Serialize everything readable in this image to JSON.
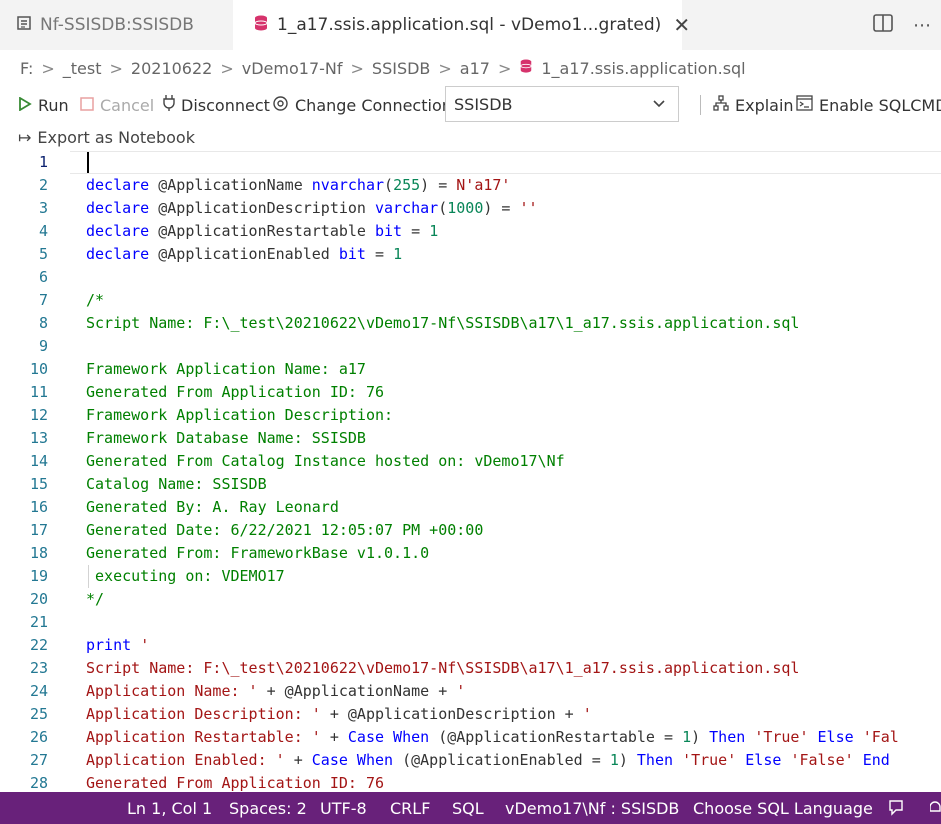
{
  "tabs": [
    {
      "label": "Nf-SSISDB:SSISDB",
      "icon": "query-doc-icon",
      "active": false
    },
    {
      "label": "1_a17.ssis.application.sql - vDemo1...grated)",
      "icon": "database-icon",
      "active": true,
      "close": "✕"
    }
  ],
  "breadcrumb": [
    "F:",
    "_test",
    "20210622",
    "vDemo17-Nf",
    "SSISDB",
    "a17",
    "1_a17.ssis.application.sql"
  ],
  "toolbar": {
    "run": "Run",
    "cancel": "Cancel",
    "disconnect": "Disconnect",
    "change_connection": "Change Connection",
    "database": "SSISDB",
    "explain": "Explain",
    "enable_sqlcmd": "Enable SQLCMD",
    "export_notebook": "Export as Notebook"
  },
  "editor": {
    "lines": [
      {
        "n": "1",
        "t": [
          {
            "c": "id",
            "v": ""
          }
        ]
      },
      {
        "n": "2",
        "t": [
          {
            "c": "kw",
            "v": "declare"
          },
          {
            "c": "id",
            "v": " @ApplicationName "
          },
          {
            "c": "kw",
            "v": "nvarchar"
          },
          {
            "c": "id",
            "v": "("
          },
          {
            "c": "nm",
            "v": "255"
          },
          {
            "c": "id",
            "v": ") = "
          },
          {
            "c": "st",
            "v": "N'a17'"
          }
        ]
      },
      {
        "n": "3",
        "t": [
          {
            "c": "kw",
            "v": "declare"
          },
          {
            "c": "id",
            "v": " @ApplicationDescription "
          },
          {
            "c": "kw",
            "v": "varchar"
          },
          {
            "c": "id",
            "v": "("
          },
          {
            "c": "nm",
            "v": "1000"
          },
          {
            "c": "id",
            "v": ") = "
          },
          {
            "c": "st",
            "v": "''"
          }
        ]
      },
      {
        "n": "4",
        "t": [
          {
            "c": "kw",
            "v": "declare"
          },
          {
            "c": "id",
            "v": " @ApplicationRestartable "
          },
          {
            "c": "kw",
            "v": "bit"
          },
          {
            "c": "id",
            "v": " = "
          },
          {
            "c": "nm",
            "v": "1"
          }
        ]
      },
      {
        "n": "5",
        "t": [
          {
            "c": "kw",
            "v": "declare"
          },
          {
            "c": "id",
            "v": " @ApplicationEnabled "
          },
          {
            "c": "kw",
            "v": "bit"
          },
          {
            "c": "id",
            "v": " = "
          },
          {
            "c": "nm",
            "v": "1"
          }
        ]
      },
      {
        "n": "6",
        "t": []
      },
      {
        "n": "7",
        "t": [
          {
            "c": "cm",
            "v": "/*"
          }
        ]
      },
      {
        "n": "8",
        "t": [
          {
            "c": "cm",
            "v": "Script Name: F:\\_test\\20210622\\vDemo17-Nf\\SSISDB\\a17\\1_a17.ssis.application.sql"
          }
        ]
      },
      {
        "n": "9",
        "t": []
      },
      {
        "n": "10",
        "t": [
          {
            "c": "cm",
            "v": "Framework Application Name: a17"
          }
        ]
      },
      {
        "n": "11",
        "t": [
          {
            "c": "cm",
            "v": "Generated From Application ID: 76"
          }
        ]
      },
      {
        "n": "12",
        "t": [
          {
            "c": "cm",
            "v": "Framework Application Description:"
          }
        ]
      },
      {
        "n": "13",
        "t": [
          {
            "c": "cm",
            "v": "Framework Database Name: SSISDB"
          }
        ]
      },
      {
        "n": "14",
        "t": [
          {
            "c": "cm",
            "v": "Generated From Catalog Instance hosted on: vDemo17\\Nf"
          }
        ]
      },
      {
        "n": "15",
        "t": [
          {
            "c": "cm",
            "v": "Catalog Name: SSISDB"
          }
        ]
      },
      {
        "n": "16",
        "t": [
          {
            "c": "cm",
            "v": "Generated By: A. Ray Leonard"
          }
        ]
      },
      {
        "n": "17",
        "t": [
          {
            "c": "cm",
            "v": "Generated Date: 6/22/2021 12:05:07 PM +00:00"
          }
        ]
      },
      {
        "n": "18",
        "t": [
          {
            "c": "cm",
            "v": "Generated From: FrameworkBase v1.0.1.0"
          }
        ]
      },
      {
        "n": "19",
        "t": [
          {
            "c": "cm",
            "v": " executing on: VDEMO17"
          }
        ],
        "guide": true
      },
      {
        "n": "20",
        "t": [
          {
            "c": "cm",
            "v": "*/"
          }
        ]
      },
      {
        "n": "21",
        "t": []
      },
      {
        "n": "22",
        "t": [
          {
            "c": "kw",
            "v": "print"
          },
          {
            "c": "id",
            "v": " "
          },
          {
            "c": "st",
            "v": "'"
          }
        ]
      },
      {
        "n": "23",
        "t": [
          {
            "c": "st",
            "v": "Script Name: F:\\_test\\20210622\\vDemo17-Nf\\SSISDB\\a17\\1_a17.ssis.application.sql"
          }
        ]
      },
      {
        "n": "24",
        "t": [
          {
            "c": "st",
            "v": "Application Name: '"
          },
          {
            "c": "id",
            "v": " + @ApplicationName + "
          },
          {
            "c": "st",
            "v": "'"
          }
        ]
      },
      {
        "n": "25",
        "t": [
          {
            "c": "st",
            "v": "Application Description: '"
          },
          {
            "c": "id",
            "v": " + @ApplicationDescription + "
          },
          {
            "c": "st",
            "v": "'"
          }
        ]
      },
      {
        "n": "26",
        "t": [
          {
            "c": "st",
            "v": "Application Restartable: '"
          },
          {
            "c": "id",
            "v": " + "
          },
          {
            "c": "kw",
            "v": "Case When"
          },
          {
            "c": "id",
            "v": " (@ApplicationRestartable = "
          },
          {
            "c": "nm",
            "v": "1"
          },
          {
            "c": "id",
            "v": ") "
          },
          {
            "c": "kw",
            "v": "Then"
          },
          {
            "c": "id",
            "v": " "
          },
          {
            "c": "st",
            "v": "'True'"
          },
          {
            "c": "id",
            "v": " "
          },
          {
            "c": "kw",
            "v": "Else"
          },
          {
            "c": "id",
            "v": " "
          },
          {
            "c": "st",
            "v": "'Fal"
          }
        ]
      },
      {
        "n": "27",
        "t": [
          {
            "c": "st",
            "v": "Application Enabled: '"
          },
          {
            "c": "id",
            "v": " + "
          },
          {
            "c": "kw",
            "v": "Case When"
          },
          {
            "c": "id",
            "v": " (@ApplicationEnabled = "
          },
          {
            "c": "nm",
            "v": "1"
          },
          {
            "c": "id",
            "v": ") "
          },
          {
            "c": "kw",
            "v": "Then"
          },
          {
            "c": "id",
            "v": " "
          },
          {
            "c": "st",
            "v": "'True'"
          },
          {
            "c": "id",
            "v": " "
          },
          {
            "c": "kw",
            "v": "Else"
          },
          {
            "c": "id",
            "v": " "
          },
          {
            "c": "st",
            "v": "'False'"
          },
          {
            "c": "id",
            "v": " "
          },
          {
            "c": "kw",
            "v": "End"
          }
        ]
      },
      {
        "n": "28",
        "t": [
          {
            "c": "st",
            "v": "Generated From Application ID: 76"
          }
        ]
      }
    ]
  },
  "status": {
    "position": "Ln 1, Col 1",
    "spaces": "Spaces: 2",
    "encoding": "UTF-8",
    "eol": "CRLF",
    "language": "SQL",
    "connection": "vDemo17\\Nf : SSISDB",
    "choose_language": "Choose SQL Language",
    "accent": "#68217a"
  }
}
